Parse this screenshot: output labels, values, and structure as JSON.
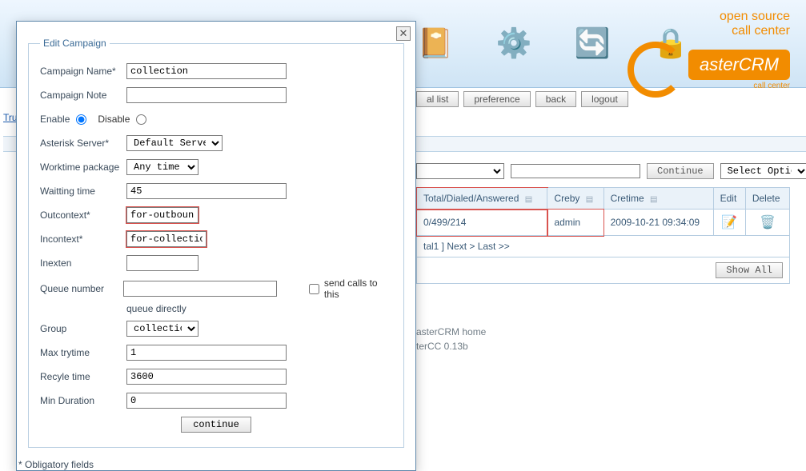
{
  "brand": {
    "line1": "open source",
    "line2": "call center",
    "name": "asterCRM",
    "sub": "call center"
  },
  "nav": {
    "diallist": "al list",
    "preference": "preference",
    "back": "back",
    "logout": "logout"
  },
  "sideLink": "Trun",
  "filter": {
    "continue": "Continue",
    "selectOption": "Select Option"
  },
  "grid": {
    "headers": {
      "totals": "Total/Dialed/Answered",
      "creby": "Creby",
      "cretime": "Cretime",
      "edit": "Edit",
      "delete": "Delete"
    },
    "row": {
      "totals": "0/499/214",
      "creby": "admin",
      "cretime": "2009-10-21 09:34:09"
    },
    "pager": "tal1 ] Next > Last >>",
    "showAll": "Show All"
  },
  "footer": {
    "home": "asterCRM home",
    "ver": "terCC 0.13b"
  },
  "modal": {
    "legend": "Edit Campaign",
    "rows": {
      "campaignNameLabel": "Campaign Name*",
      "campaignName": "collection",
      "campaignNoteLabel": "Campaign Note",
      "campaignNote": "",
      "enableLabel": "Enable",
      "disableLabel": "Disable",
      "asteriskLabel": "Asterisk Server*",
      "asteriskServer": "Default Server",
      "worktimeLabel": "Worktime package",
      "worktime": "Any time",
      "waitingLabel": "Waitting time",
      "waiting": "45",
      "outcontextLabel": "Outcontext*",
      "outcontext": "for-outbound",
      "incontextLabel": "Incontext*",
      "incontext": "for-collection",
      "inextenLabel": "Inexten",
      "inexten": "",
      "queueLabel": "Queue number",
      "queue": "",
      "queueCheck": "send calls to this queue directly",
      "groupLabel": "Group",
      "group": "collection",
      "maxtryLabel": "Max trytime",
      "maxtry": "1",
      "recycleLabel": "Recyle time",
      "recycle": "3600",
      "minDurLabel": "Min Duration",
      "minDur": "0"
    },
    "continue": "continue",
    "obligatory": "* Obligatory fields"
  }
}
